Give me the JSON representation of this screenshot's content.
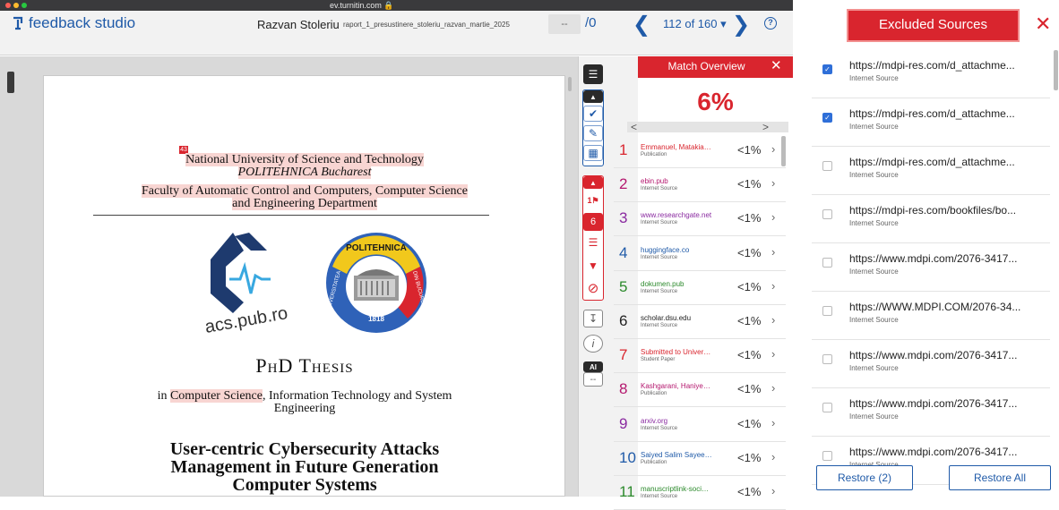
{
  "browser": {
    "url": "ev.turnitin.com"
  },
  "header": {
    "logo": "feedback studio",
    "author": "Razvan Stoleriu",
    "filename": "raport_1_presustinere_stoleriu_razvan_martie_2025",
    "grade_value": "--",
    "grade_total": "/0",
    "page_count": "112 of 160 ▾"
  },
  "document": {
    "match_marker": "43",
    "university_line1": "National University of Science and Technology",
    "university_line2": "POLITEHNICA Bucharest",
    "faculty_line1": "Faculty of Automatic Control and Computers, Computer Science",
    "faculty_line2": "and Engineering Department",
    "logo_text": "acs.pub.ro",
    "seal_top": "POLITEHNICA",
    "seal_left": "UNIVERSITATEA",
    "seal_right": "DIN BUCUREȘTI",
    "seal_year": "1818",
    "thesis_type": "PhD Thesis",
    "field_prefix": "in ",
    "field_highlight": "Computer Science",
    "field_rest": ", Information Technology and System",
    "field_line2": "Engineering",
    "title_line1": "User-centric Cybersecurity Attacks",
    "title_line2": "Management in Future Generation",
    "title_line3": "Computer Systems"
  },
  "toolbar": {
    "match_count": "6",
    "top_source_label": "1",
    "ai_label": "AI",
    "ai_value": "--"
  },
  "match_overview": {
    "title": "Match Overview",
    "percent": "6%",
    "rows": [
      {
        "num": "1",
        "name": "Emmanuel, Matakias. \"...",
        "type": "Publication",
        "pct": "<1%",
        "color": "#d9252e"
      },
      {
        "num": "2",
        "name": "ebin.pub",
        "type": "Internet Source",
        "pct": "<1%",
        "color": "#b4176e"
      },
      {
        "num": "3",
        "name": "www.researchgate.net",
        "type": "Internet Source",
        "pct": "<1%",
        "color": "#8a2aa0"
      },
      {
        "num": "4",
        "name": "huggingface.co",
        "type": "Internet Source",
        "pct": "<1%",
        "color": "#1f5aa8"
      },
      {
        "num": "5",
        "name": "dokumen.pub",
        "type": "Internet Source",
        "pct": "<1%",
        "color": "#2c8a2c"
      },
      {
        "num": "6",
        "name": "scholar.dsu.edu",
        "type": "Internet Source",
        "pct": "<1%",
        "color": "#222222"
      },
      {
        "num": "7",
        "name": "Submitted to University...",
        "type": "Student Paper",
        "pct": "<1%",
        "color": "#d9252e"
      },
      {
        "num": "8",
        "name": "Kashgarani, Haniye. \"D...",
        "type": "Publication",
        "pct": "<1%",
        "color": "#b4176e"
      },
      {
        "num": "9",
        "name": "arxiv.org",
        "type": "Internet Source",
        "pct": "<1%",
        "color": "#8a2aa0"
      },
      {
        "num": "10",
        "name": "Saiyed Salim Sayeed, H...",
        "type": "Publication",
        "pct": "<1%",
        "color": "#1f5aa8"
      },
      {
        "num": "11",
        "name": "manuscriptlink-society-...",
        "type": "Internet Source",
        "pct": "<1%",
        "color": "#2c8a2c"
      }
    ]
  },
  "excluded": {
    "title": "Excluded Sources",
    "rows": [
      {
        "url": "https://mdpi-res.com/d_attachme...",
        "type": "Internet Source",
        "checked": true
      },
      {
        "url": "https://mdpi-res.com/d_attachme...",
        "type": "Internet Source",
        "checked": true
      },
      {
        "url": "https://mdpi-res.com/d_attachme...",
        "type": "Internet Source",
        "checked": false
      },
      {
        "url": "https://mdpi-res.com/bookfiles/bo...",
        "type": "Internet Source",
        "checked": false
      },
      {
        "url": "https://www.mdpi.com/2076-3417...",
        "type": "Internet Source",
        "checked": false
      },
      {
        "url": "https://WWW.MDPI.COM/2076-34...",
        "type": "Internet Source",
        "checked": false
      },
      {
        "url": "https://www.mdpi.com/2076-3417...",
        "type": "Internet Source",
        "checked": false
      },
      {
        "url": "https://www.mdpi.com/2076-3417...",
        "type": "Internet Source",
        "checked": false
      },
      {
        "url": "https://www.mdpi.com/2076-3417...",
        "type": "Internet Source",
        "checked": false
      }
    ],
    "restore_label": "Restore (2)",
    "restore_all_label": "Restore All"
  },
  "colors": {
    "accent_red": "#d9252e",
    "brand_blue": "#1f5aa8",
    "checkbox_blue": "#2f6fd8"
  }
}
